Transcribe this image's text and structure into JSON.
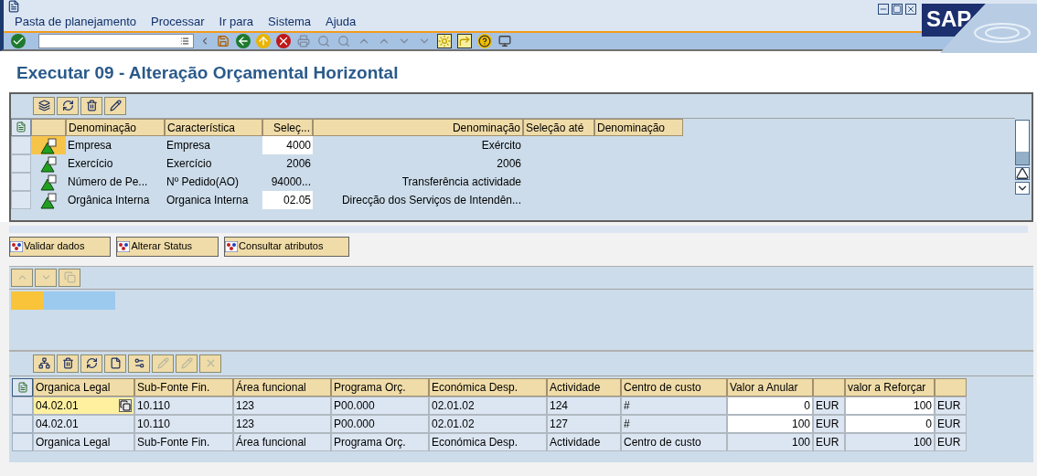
{
  "menu": [
    "Pasta de planejamento",
    "Processar",
    "Ir para",
    "Sistema",
    "Ajuda"
  ],
  "logo": "SAP",
  "title": "Executar 09 - Alteração Orçamental Horizontal",
  "selection_table": {
    "columns": [
      "Denominação",
      "Característica",
      "Seleç...",
      "Denominação",
      "Seleção até",
      "Denominação"
    ],
    "rows": [
      {
        "selected": true,
        "cells": [
          "Empresa",
          "Empresa",
          "4000",
          "Exército"
        ],
        "editable": true
      },
      {
        "selected": false,
        "cells": [
          "Exercício",
          "Exercício",
          "2006",
          "2006"
        ],
        "editable": false
      },
      {
        "selected": false,
        "cells": [
          "Número de Pe...",
          "Nº Pedido(AO)",
          "94000...",
          "Transferência actividade"
        ],
        "editable": false
      },
      {
        "selected": false,
        "cells": [
          "Orgânica Interna",
          "Organica Interna",
          "02.05",
          "Direcção dos Serviços de Intendên..."
        ],
        "editable": true
      }
    ]
  },
  "action_buttons": [
    "Validar dados",
    "Alterar Status",
    "Consultar atributos"
  ],
  "data_table": {
    "columns": [
      {
        "label": "Organica Legal"
      },
      {
        "label": "Sub-Fonte Fin."
      },
      {
        "label": "Área funcional"
      },
      {
        "label": "Programa Orç."
      },
      {
        "label": "Económica Desp."
      },
      {
        "label": "Actividade"
      },
      {
        "label": "Centro de custo"
      },
      {
        "label": "Valor a Anular"
      },
      {
        "kind": "unit"
      },
      {
        "label": "valor a Reforçar"
      },
      {
        "kind": "unit"
      }
    ],
    "rows": [
      {
        "kind": "entry",
        "focused": true,
        "cells": [
          "04.02.01",
          "10.110",
          "123",
          "P00.000",
          "02.01.02",
          "124",
          "#",
          "0",
          "EUR",
          "100",
          "EUR"
        ]
      },
      {
        "kind": "entry",
        "focused": false,
        "cells": [
          "04.02.01",
          "10.110",
          "123",
          "P00.000",
          "02.01.02",
          "127",
          "#",
          "100",
          "EUR",
          "0",
          "EUR"
        ]
      },
      {
        "kind": "total",
        "focused": false,
        "cells": [
          "Organica Legal",
          "Sub-Fonte Fin.",
          "Área funcional",
          "Programa Orç.",
          "Económica Desp.",
          "Actividade",
          "Centro de custo",
          "100",
          "EUR",
          "100",
          "EUR"
        ]
      }
    ]
  }
}
